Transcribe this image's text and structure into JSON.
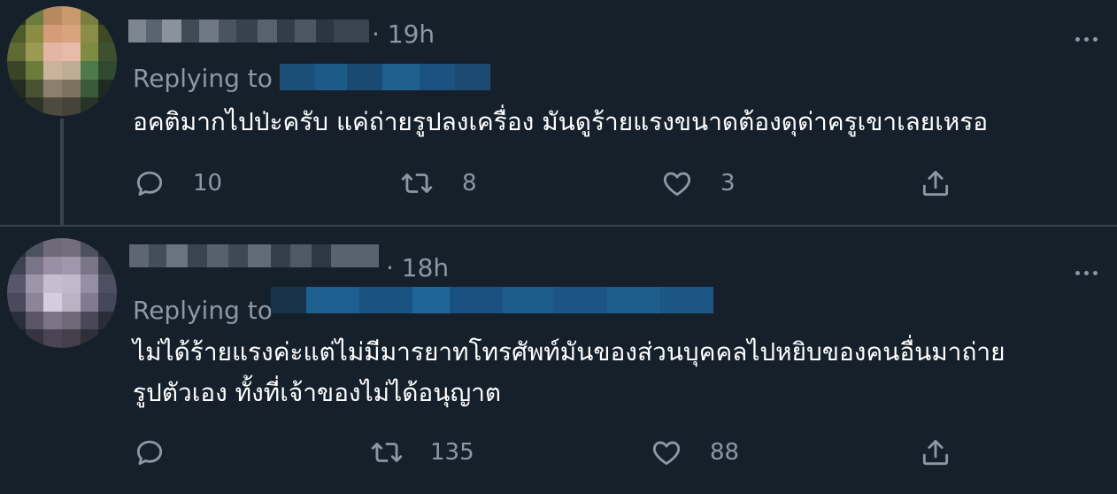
{
  "tweets": [
    {
      "time": "· 19h",
      "replying_label": "Replying to",
      "text": "อคติมากไปป่ะครับ แค่ถ่ายรูปลงเครื่อง มันดูร้ายแรงขนาดต้องดุด่าครูเขาเลยเหรอ",
      "reply_count": "10",
      "retweet_count": "8",
      "like_count": "3",
      "icons": [
        "reply-icon",
        "retweet-icon",
        "like-icon",
        "share-icon",
        "more-icon"
      ]
    },
    {
      "time": "· 18h",
      "replying_label": "Replying to",
      "text_line1": "ไม่ได้ร้ายแรงค่ะแต่ไม่มีมารยาทโทรศัพท์มันของส่วนบุคคลไปหยิบของคนอื่นมาถ่าย",
      "text_line2": "รูปตัวเอง ทั้งที่เจ้าของไม่ได้อนุญาต",
      "reply_count": "",
      "retweet_count": "135",
      "like_count": "88",
      "icons": [
        "reply-icon",
        "retweet-icon",
        "like-icon",
        "share-icon",
        "more-icon"
      ]
    }
  ],
  "colors": {
    "background": "#15202b",
    "secondary_text": "#8b98a5",
    "blurred_handle": "#1d5f8f"
  }
}
